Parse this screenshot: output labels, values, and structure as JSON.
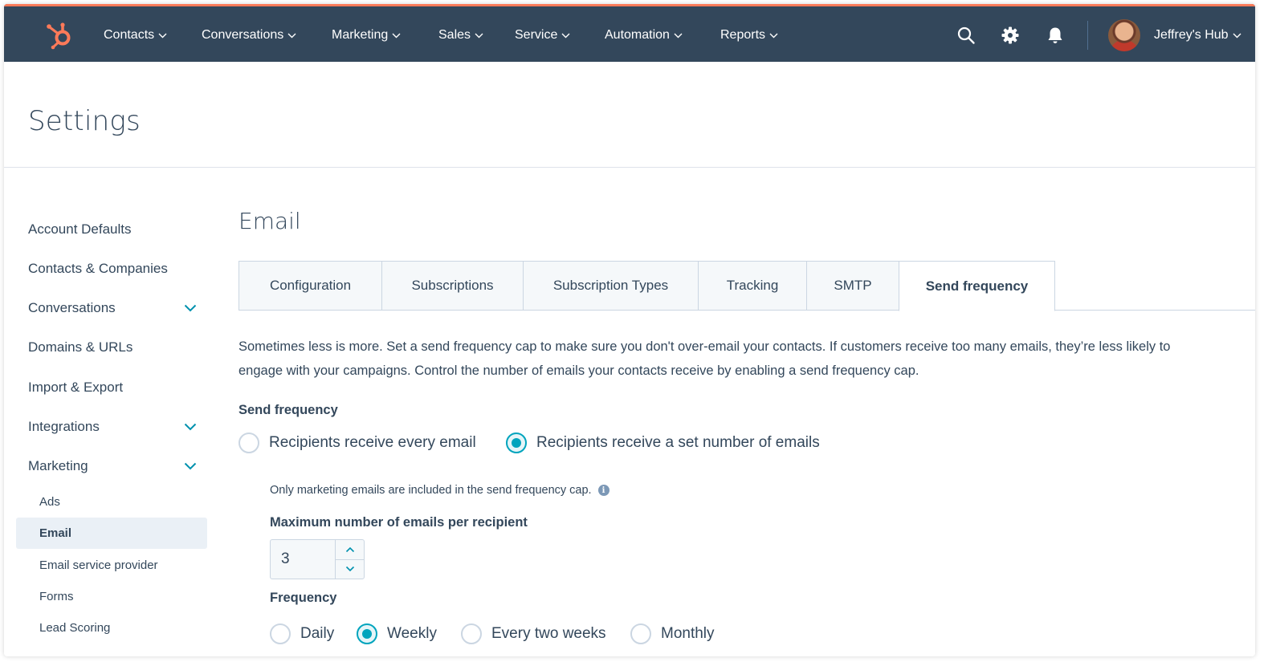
{
  "colors": {
    "nav_bg": "#33475b",
    "nav_accent": "#ff7a59",
    "brand_orange": "#ff7a59",
    "radio_accent": "#00a4bd",
    "active_sidebar_bg": "#eaf0f6",
    "text": "#33475b"
  },
  "topnav": {
    "logo_icon": "hubspot-sprocket-icon",
    "items": [
      {
        "label": "Contacts"
      },
      {
        "label": "Conversations"
      },
      {
        "label": "Marketing"
      },
      {
        "label": "Sales"
      },
      {
        "label": "Service"
      },
      {
        "label": "Automation"
      },
      {
        "label": "Reports"
      }
    ],
    "icons": [
      "search-icon",
      "gear-icon",
      "bell-icon"
    ],
    "account": {
      "name": "Jeffrey's Hub",
      "avatar_icon": "avatar-photo"
    }
  },
  "page": {
    "title": "Settings"
  },
  "sidebar": {
    "items": [
      {
        "label": "Account Defaults",
        "expandable": false
      },
      {
        "label": "Contacts & Companies",
        "expandable": false
      },
      {
        "label": "Conversations",
        "expandable": true
      },
      {
        "label": "Domains & URLs",
        "expandable": false
      },
      {
        "label": "Import & Export",
        "expandable": false
      },
      {
        "label": "Integrations",
        "expandable": true
      },
      {
        "label": "Marketing",
        "expandable": true,
        "expanded": true
      }
    ],
    "marketing_subitems": [
      {
        "label": "Ads"
      },
      {
        "label": "Email",
        "active": true
      },
      {
        "label": "Email service provider"
      },
      {
        "label": "Forms"
      },
      {
        "label": "Lead Scoring"
      }
    ]
  },
  "main": {
    "section_title": "Email",
    "tabs": [
      {
        "label": "Configuration"
      },
      {
        "label": "Subscriptions"
      },
      {
        "label": "Subscription Types"
      },
      {
        "label": "Tracking"
      },
      {
        "label": "SMTP"
      },
      {
        "label": "Send frequency",
        "active": true
      }
    ],
    "description_line1": "Sometimes less is more. Set a send frequency cap to make sure you don't over-email your contacts. If customers receive too many emails, they’re less likely to",
    "description_line2": "engage with your campaigns. Control the number of emails your contacts receive by enabling a send frequency cap.",
    "send_frequency": {
      "label": "Send frequency",
      "options": [
        {
          "label": "Recipients receive every email",
          "checked": false
        },
        {
          "label": "Recipients receive a set number of emails",
          "checked": true
        }
      ]
    },
    "note": "Only marketing emails are included in the send frequency cap.",
    "max_emails": {
      "label": "Maximum number of emails per recipient",
      "value": "3"
    },
    "frequency": {
      "label": "Frequency",
      "options": [
        {
          "label": "Daily",
          "checked": false
        },
        {
          "label": "Weekly",
          "checked": true
        },
        {
          "label": "Every two weeks",
          "checked": false
        },
        {
          "label": "Monthly",
          "checked": false
        }
      ]
    }
  }
}
